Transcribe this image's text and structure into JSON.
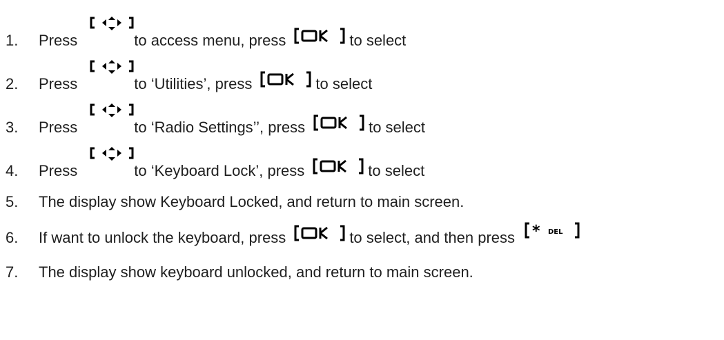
{
  "keys": {
    "nav_icon": "nav-arrows-icon",
    "ok_label": "OK",
    "del_label": "DEL"
  },
  "steps": [
    {
      "num": "1.",
      "press": "Press",
      "middle": "to access menu, press",
      "end": "to select"
    },
    {
      "num": "2.",
      "press": "Press",
      "middle": "to ‘Utilities’, press",
      "end": "to select"
    },
    {
      "num": "3.",
      "press": "Press",
      "middle": "to ‘Radio Settings’’, press",
      "end": "to select"
    },
    {
      "num": "4.",
      "press": "Press",
      "middle": "to ‘Keyboard Lock’, press",
      "end": "to select"
    },
    {
      "num": "5.",
      "text": "The display show Keyboard Locked, and return to main screen."
    },
    {
      "num": "6.",
      "text": "If want to unlock the keyboard, press",
      "middle": "to select, and then press"
    },
    {
      "num": "7.",
      "text": "The display show keyboard unlocked, and return to main screen."
    }
  ]
}
